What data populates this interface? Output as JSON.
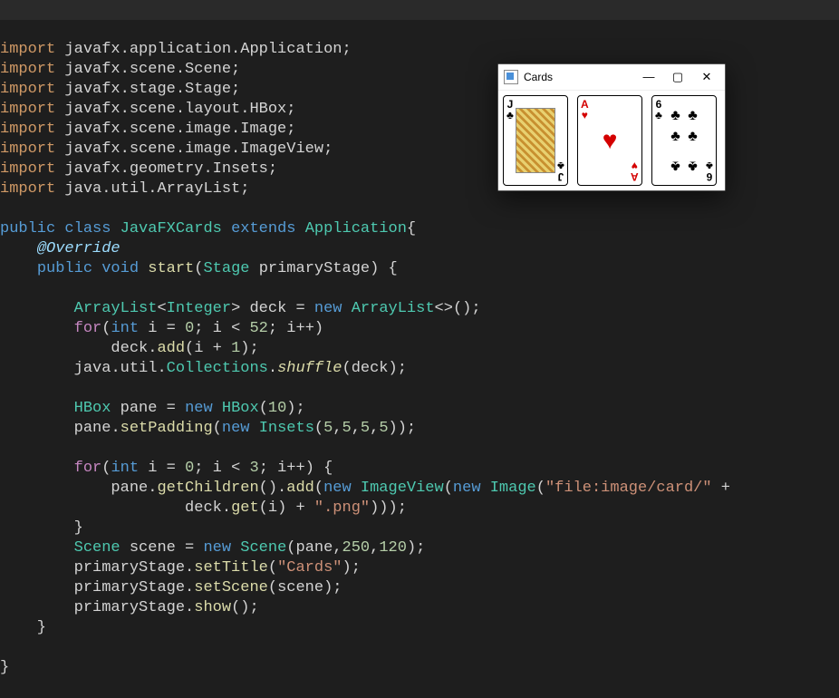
{
  "code": {
    "imports": [
      "javafx.application.Application;",
      "javafx.scene.Scene;",
      "javafx.stage.Stage;",
      "javafx.scene.layout.HBox;",
      "javafx.scene.image.Image;",
      "javafx.scene.image.ImageView;",
      "javafx.geometry.Insets;",
      "java.util.ArrayList;"
    ],
    "class_decl": {
      "kw_public": "public",
      "kw_class": "class",
      "name": "JavaFXCards",
      "kw_extends": "extends",
      "parent": "Application"
    },
    "override": "@Override",
    "method_sig": {
      "kw_public": "public",
      "kw_void": "void",
      "name": "start",
      "param_type": "Stage",
      "param_name": "primaryStage"
    },
    "deck_line": {
      "type1": "ArrayList",
      "generic": "Integer",
      "var": "deck",
      "kw_new": "new",
      "type2": "ArrayList"
    },
    "for1": {
      "kw_for": "for",
      "kw_int": "int",
      "var": "i",
      "init": "0",
      "cond_var": "i",
      "limit": "52",
      "inc": "i++"
    },
    "deck_add": {
      "obj": "deck",
      "method": "add",
      "arg_var": "i",
      "plus": "1"
    },
    "shuffle": {
      "pkg1": "java",
      "pkg2": "util",
      "cls": "Collections",
      "method": "shuffle",
      "arg": "deck"
    },
    "hbox": {
      "type": "HBox",
      "var": "pane",
      "kw_new": "new",
      "ctor": "HBox",
      "arg": "10"
    },
    "padding": {
      "obj": "pane",
      "method": "setPadding",
      "kw_new": "new",
      "type": "Insets",
      "a": "5",
      "b": "5",
      "c": "5",
      "d": "5"
    },
    "for2": {
      "kw_for": "for",
      "kw_int": "int",
      "var": "i",
      "init": "0",
      "cond_var": "i",
      "limit": "3",
      "inc": "i++"
    },
    "add_children": {
      "obj": "pane",
      "getChildren": "getChildren",
      "add": "add",
      "kw_new1": "new",
      "ImageView": "ImageView",
      "kw_new2": "new",
      "Image": "Image",
      "str1": "\"file:image/card/\"",
      "deck": "deck",
      "get": "get",
      "idx": "i",
      "str2": "\".png\""
    },
    "scene": {
      "type": "Scene",
      "var": "scene",
      "kw_new": "new",
      "ctor": "Scene",
      "pane": "pane",
      "w": "250",
      "h": "120"
    },
    "title": {
      "obj": "primaryStage",
      "method": "setTitle",
      "arg": "\"Cards\""
    },
    "setscene": {
      "obj": "primaryStage",
      "method": "setScene",
      "arg": "scene"
    },
    "show": {
      "obj": "primaryStage",
      "method": "show"
    },
    "import_kw": "import"
  },
  "window": {
    "title": "Cards",
    "cards": [
      {
        "rank": "J",
        "suit": "♣",
        "color": "black",
        "kind": "jack"
      },
      {
        "rank": "A",
        "suit": "♥",
        "color": "red",
        "kind": "ace"
      },
      {
        "rank": "6",
        "suit": "♣",
        "color": "black",
        "kind": "six"
      }
    ]
  }
}
